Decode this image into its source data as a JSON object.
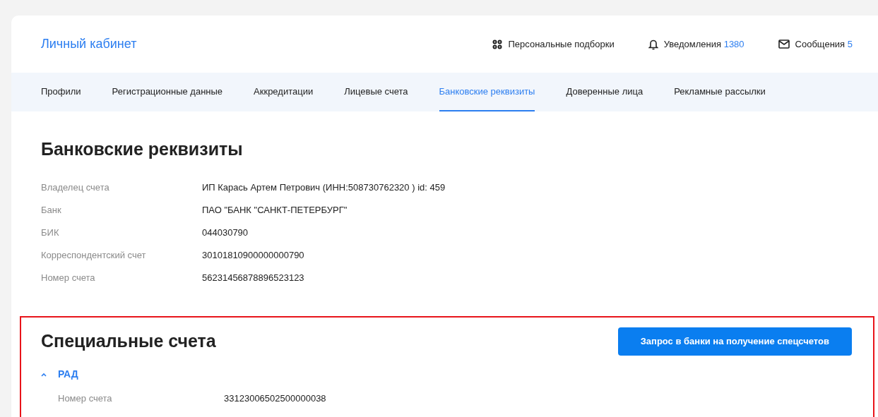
{
  "header": {
    "title": "Личный кабинет",
    "links": [
      {
        "kind": "collections",
        "label": "Персональные подборки"
      },
      {
        "kind": "notifications",
        "label": "Уведомления",
        "count": "1380"
      },
      {
        "kind": "messages",
        "label": "Сообщения",
        "count": "5"
      }
    ]
  },
  "tabs": [
    {
      "label": "Профили",
      "selected": false
    },
    {
      "label": "Регистрационные данные",
      "selected": false
    },
    {
      "label": "Аккредитации",
      "selected": false
    },
    {
      "label": "Лицевые счета",
      "selected": false
    },
    {
      "label": "Банковские реквизиты",
      "selected": true
    },
    {
      "label": "Доверенные лица",
      "selected": false
    },
    {
      "label": "Рекламные рассылки",
      "selected": false
    }
  ],
  "bank_details": {
    "title": "Банковские реквизиты",
    "fields": [
      {
        "label": "Владелец счета",
        "value": "ИП Карась Артем Петрович (ИНН:508730762320 ) id: 459"
      },
      {
        "label": "Банк",
        "value": "ПАО \"БАНК \"САНКТ-ПЕТЕРБУРГ\""
      },
      {
        "label": "БИК",
        "value": "044030790"
      },
      {
        "label": "Корреспондентский счет",
        "value": "30101810900000000790"
      },
      {
        "label": "Номер счета",
        "value": "56231456878896523123"
      }
    ]
  },
  "special_accounts": {
    "title": "Специальные счета",
    "button": "Запрос в банки на получение спецсчетов",
    "groups": [
      {
        "name": "РАД",
        "expanded": true,
        "fields": [
          {
            "label": "Номер счета",
            "value": "33123006502500000038"
          }
        ]
      }
    ]
  }
}
